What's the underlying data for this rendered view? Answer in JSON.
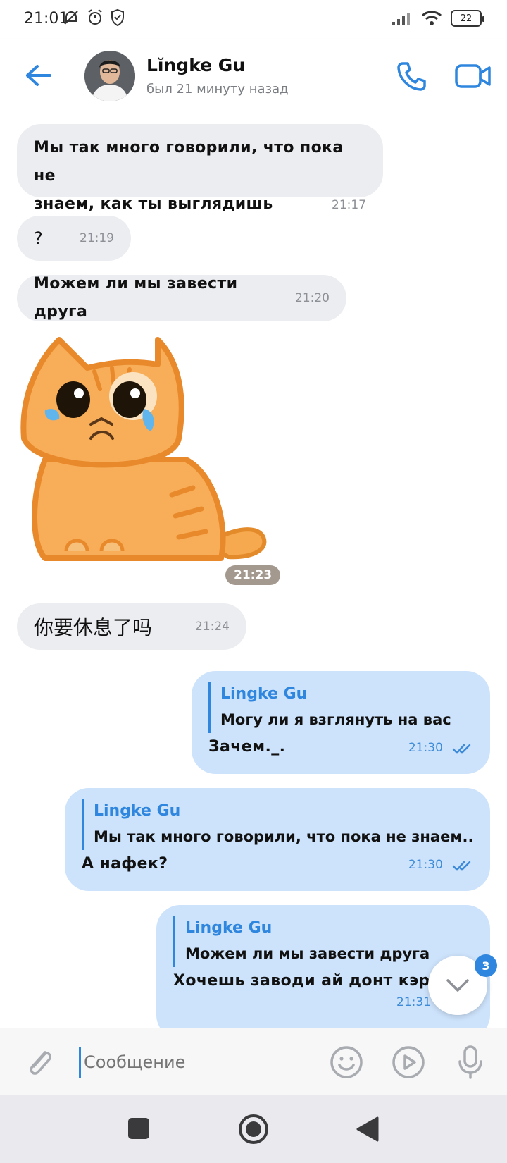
{
  "status_bar": {
    "time": "21:01",
    "battery": "22"
  },
  "header": {
    "contact_name": "Lĭngke Gu",
    "last_seen": "был 21 минуту назад"
  },
  "messages": [
    {
      "direction": "in",
      "text_line1": "Мы так много говорили, что пока не",
      "text_line2": "знаем, как ты выглядишь",
      "time": "21:17"
    },
    {
      "direction": "in",
      "text": "?",
      "time": "21:19"
    },
    {
      "direction": "in",
      "text": "Можем ли мы завести друга",
      "time": "21:20"
    },
    {
      "direction": "in",
      "type": "sticker",
      "sticker": "crying-cat",
      "time": "21:23"
    },
    {
      "direction": "in",
      "text": "你要休息了吗",
      "time": "21:24"
    },
    {
      "direction": "out",
      "reply_author": "Lingke Gu",
      "reply_text": "Могу ли я взглянуть на вас",
      "text": "Зачем._.",
      "time": "21:30"
    },
    {
      "direction": "out",
      "reply_author": "Lingke Gu",
      "reply_text": "Мы так много говорили, что пока не знаем...",
      "text": "А нафек?",
      "time": "21:30"
    },
    {
      "direction": "out",
      "reply_author": "Lingke Gu",
      "reply_text": "Можем ли мы завести друга",
      "text": "Хочешь заводи ай донт кэр",
      "time": "21:31"
    }
  ],
  "scroll_down": {
    "unread_count": "3"
  },
  "input": {
    "placeholder": "Сообщение"
  },
  "colors": {
    "accent": "#2f86de",
    "incoming_bubble": "#ecedf1",
    "outgoing_bubble": "#cde3fb"
  },
  "icons": [
    "back-arrow-icon",
    "phone-icon",
    "video-camera-icon",
    "paperclip-icon",
    "emoji-icon",
    "play-circle-icon",
    "microphone-icon",
    "chevron-down-icon",
    "double-check-icon"
  ]
}
